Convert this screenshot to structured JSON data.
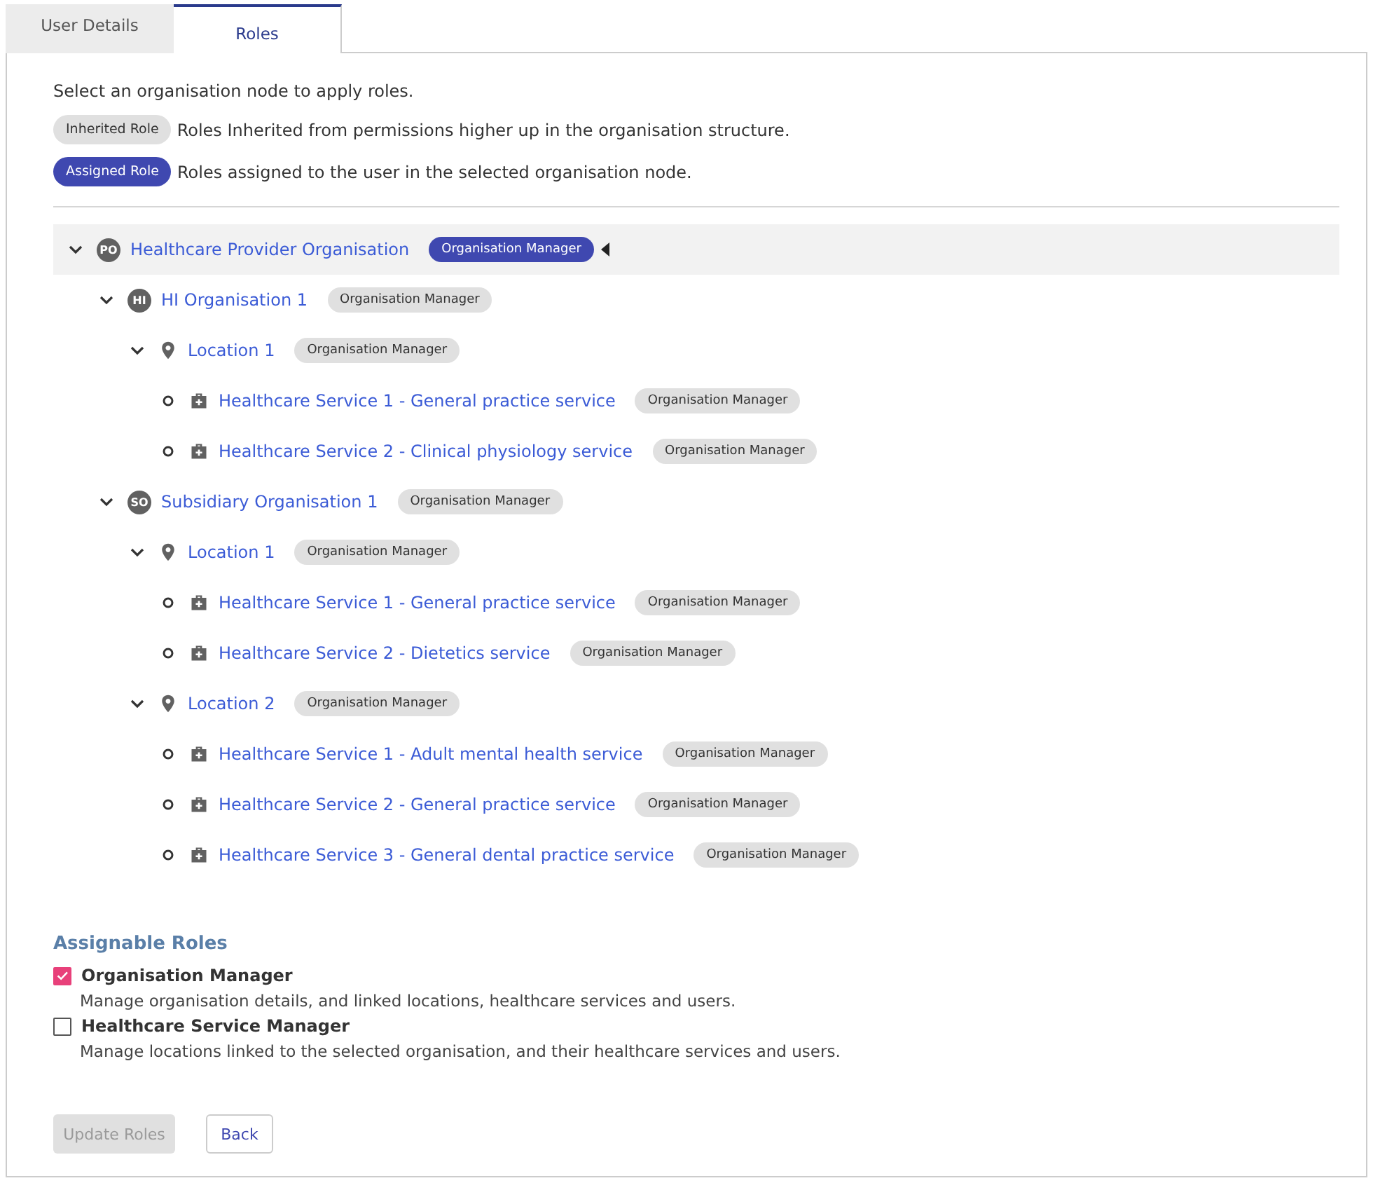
{
  "tabs": [
    {
      "label": "User Details",
      "selected": false
    },
    {
      "label": "Roles",
      "selected": true
    }
  ],
  "intro": "Select an organisation node to apply roles.",
  "legend": [
    {
      "kind": "inherited",
      "label": "Inherited Role",
      "text": "Roles Inherited from permissions higher up in the organisation structure."
    },
    {
      "kind": "assigned",
      "label": "Assigned Role",
      "text": "Roles assigned to the user in the selected organisation node."
    }
  ],
  "tree": [
    {
      "kind": "org",
      "initials": "PO",
      "label": "Healthcare Provider Organisation",
      "expanded": true,
      "selected": true,
      "role": {
        "label": "Organisation Manager",
        "kind": "assigned"
      },
      "children": [
        {
          "kind": "org",
          "initials": "HI",
          "label": "HI Organisation 1",
          "expanded": true,
          "selected": false,
          "role": {
            "label": "Organisation Manager",
            "kind": "inherited"
          },
          "children": [
            {
              "kind": "location",
              "label": "Location 1",
              "expanded": true,
              "selected": false,
              "role": {
                "label": "Organisation Manager",
                "kind": "inherited"
              },
              "children": [
                {
                  "kind": "service",
                  "label": "Healthcare Service 1 - General practice service",
                  "selected": false,
                  "role": {
                    "label": "Organisation Manager",
                    "kind": "inherited"
                  }
                },
                {
                  "kind": "service",
                  "label": "Healthcare Service 2 - Clinical physiology service",
                  "selected": false,
                  "role": {
                    "label": "Organisation Manager",
                    "kind": "inherited"
                  }
                }
              ]
            }
          ]
        },
        {
          "kind": "org",
          "initials": "SO",
          "label": "Subsidiary Organisation 1",
          "expanded": true,
          "selected": false,
          "role": {
            "label": "Organisation Manager",
            "kind": "inherited"
          },
          "children": [
            {
              "kind": "location",
              "label": "Location 1",
              "expanded": true,
              "selected": false,
              "role": {
                "label": "Organisation Manager",
                "kind": "inherited"
              },
              "children": [
                {
                  "kind": "service",
                  "label": "Healthcare Service 1 - General practice service",
                  "selected": false,
                  "role": {
                    "label": "Organisation Manager",
                    "kind": "inherited"
                  }
                },
                {
                  "kind": "service",
                  "label": "Healthcare Service 2 - Dietetics service",
                  "selected": false,
                  "role": {
                    "label": "Organisation Manager",
                    "kind": "inherited"
                  }
                }
              ]
            },
            {
              "kind": "location",
              "label": "Location 2",
              "expanded": true,
              "selected": false,
              "role": {
                "label": "Organisation Manager",
                "kind": "inherited"
              },
              "children": [
                {
                  "kind": "service",
                  "label": "Healthcare Service 1 - Adult mental health service",
                  "selected": false,
                  "role": {
                    "label": "Organisation Manager",
                    "kind": "inherited"
                  }
                },
                {
                  "kind": "service",
                  "label": "Healthcare Service 2 - General practice service",
                  "selected": false,
                  "role": {
                    "label": "Organisation Manager",
                    "kind": "inherited"
                  }
                },
                {
                  "kind": "service",
                  "label": "Healthcare Service 3 - General dental practice service",
                  "selected": false,
                  "role": {
                    "label": "Organisation Manager",
                    "kind": "inherited"
                  }
                }
              ]
            }
          ]
        }
      ]
    }
  ],
  "assignable_title": "Assignable Roles",
  "roles": [
    {
      "label": "Organisation Manager",
      "description": "Manage organisation details, and linked locations, healthcare services and users.",
      "checked": true
    },
    {
      "label": "Healthcare Service Manager",
      "description": "Manage locations linked to the selected organisation, and their healthcare services and users.",
      "checked": false
    }
  ],
  "buttons": [
    {
      "label": "Update Roles",
      "kind": "primary",
      "disabled": true
    },
    {
      "label": "Back",
      "kind": "secondary",
      "disabled": false
    }
  ]
}
